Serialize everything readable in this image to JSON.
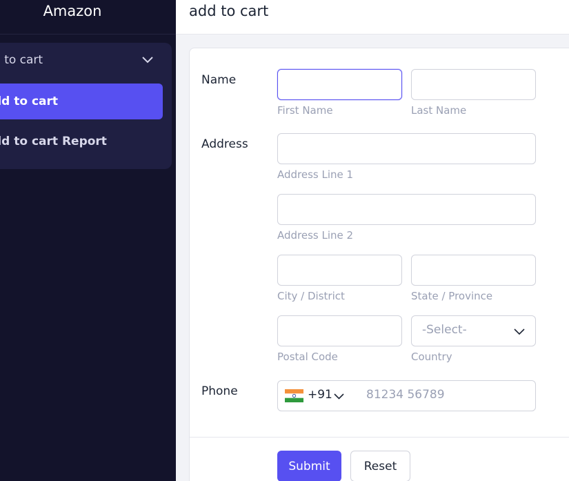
{
  "sidebar": {
    "brand": "Amazon",
    "menu": {
      "parent_label": "d to cart",
      "active_label": "dd to cart",
      "report_label": "dd to cart Report"
    }
  },
  "header": {
    "title": "add to cart"
  },
  "form": {
    "name": {
      "label": "Name",
      "first_hint": "First Name",
      "last_hint": "Last Name"
    },
    "address": {
      "label": "Address",
      "line1_hint": "Address Line 1",
      "line2_hint": "Address Line 2",
      "city_hint": "City / District",
      "state_hint": "State / Province",
      "postal_hint": "Postal Code",
      "country_hint": "Country",
      "country_select": "-Select-"
    },
    "phone": {
      "label": "Phone",
      "country_code": "+91",
      "placeholder": "81234 56789",
      "flag_icon": "india-flag-icon"
    },
    "buttons": {
      "submit": "Submit",
      "reset": "Reset"
    }
  },
  "colors": {
    "accent": "#5750f1",
    "sidebar_bg": "#13132b",
    "menu_bg": "#1f1f42"
  }
}
